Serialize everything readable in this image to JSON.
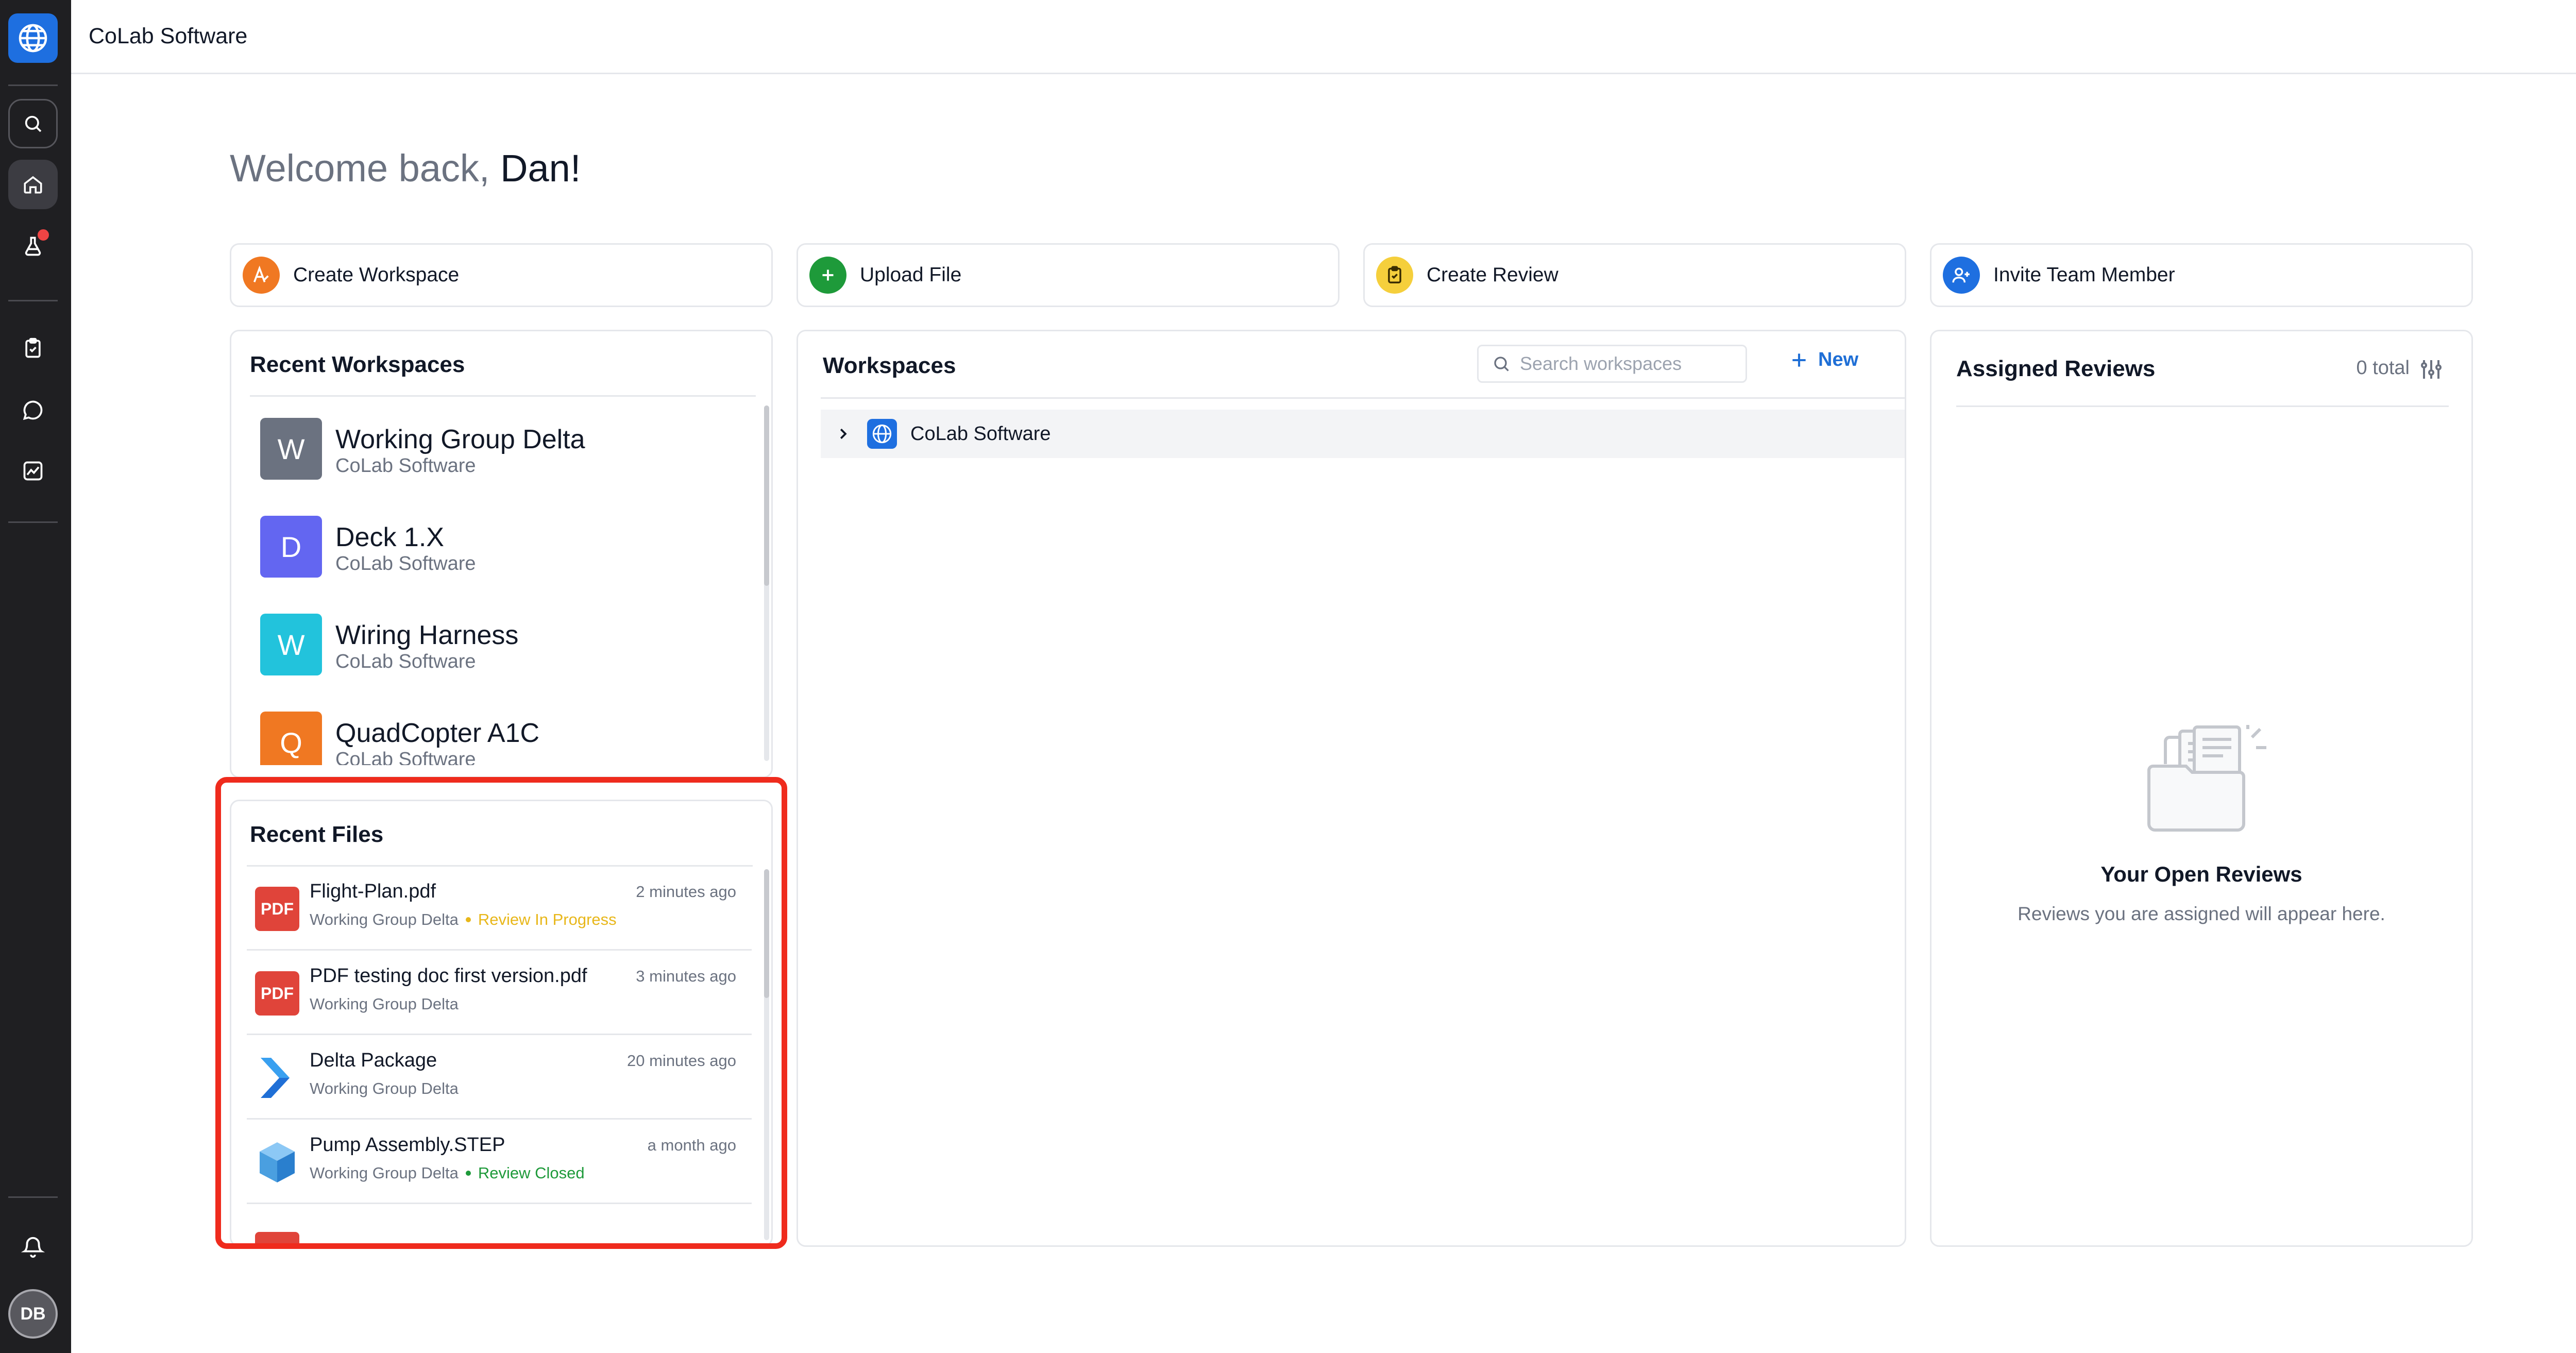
{
  "app": {
    "title": "CoLab Software",
    "user_initials": "DB"
  },
  "welcome": {
    "greeting": "Welcome back,",
    "name": "Dan!"
  },
  "actions": [
    {
      "label": "Create Workspace",
      "icon": "create-workspace-icon",
      "color": "#f07822"
    },
    {
      "label": "Upload File",
      "icon": "plus-icon",
      "color": "#1e9a3a"
    },
    {
      "label": "Create Review",
      "icon": "review-clipboard-icon",
      "color": "#f5cf3c"
    },
    {
      "label": "Invite Team Member",
      "icon": "add-user-icon",
      "color": "#1e6fe0"
    }
  ],
  "recent_workspaces": {
    "title": "Recent Workspaces",
    "items": [
      {
        "initial": "W",
        "name": "Working Group Delta",
        "org": "CoLab Software",
        "color": "#6b7280"
      },
      {
        "initial": "D",
        "name": "Deck 1.X",
        "org": "CoLab Software",
        "color": "#6366f1"
      },
      {
        "initial": "W",
        "name": "Wiring Harness",
        "org": "CoLab Software",
        "color": "#22c3dc"
      },
      {
        "initial": "Q",
        "name": "QuadCopter A1C",
        "org": "CoLab Software",
        "color": "#f07822"
      }
    ]
  },
  "recent_files": {
    "title": "Recent Files",
    "items": [
      {
        "name": "Flight-Plan.pdf",
        "workspace": "Working Group Delta",
        "status": "Review In Progress",
        "status_color": "#e8b71a",
        "time": "2 minutes ago",
        "type": "pdf",
        "badge": "PDF"
      },
      {
        "name": "PDF testing doc first version.pdf",
        "workspace": "Working Group Delta",
        "status": "",
        "status_color": "",
        "time": "3 minutes ago",
        "type": "pdf",
        "badge": "PDF"
      },
      {
        "name": "Delta Package",
        "workspace": "Working Group Delta",
        "status": "",
        "status_color": "",
        "time": "20 minutes ago",
        "type": "package",
        "badge": ""
      },
      {
        "name": "Pump Assembly.STEP",
        "workspace": "Working Group Delta",
        "status": "Review Closed",
        "status_color": "#1e9a3a",
        "time": "a month ago",
        "type": "step",
        "badge": ""
      }
    ]
  },
  "workspaces": {
    "title": "Workspaces",
    "search_placeholder": "Search workspaces",
    "new_label": "New",
    "tree": [
      {
        "label": "CoLab Software"
      }
    ]
  },
  "assigned_reviews": {
    "title": "Assigned Reviews",
    "count": "0 total",
    "empty_title": "Your Open Reviews",
    "empty_text": "Reviews you are assigned will appear here."
  }
}
